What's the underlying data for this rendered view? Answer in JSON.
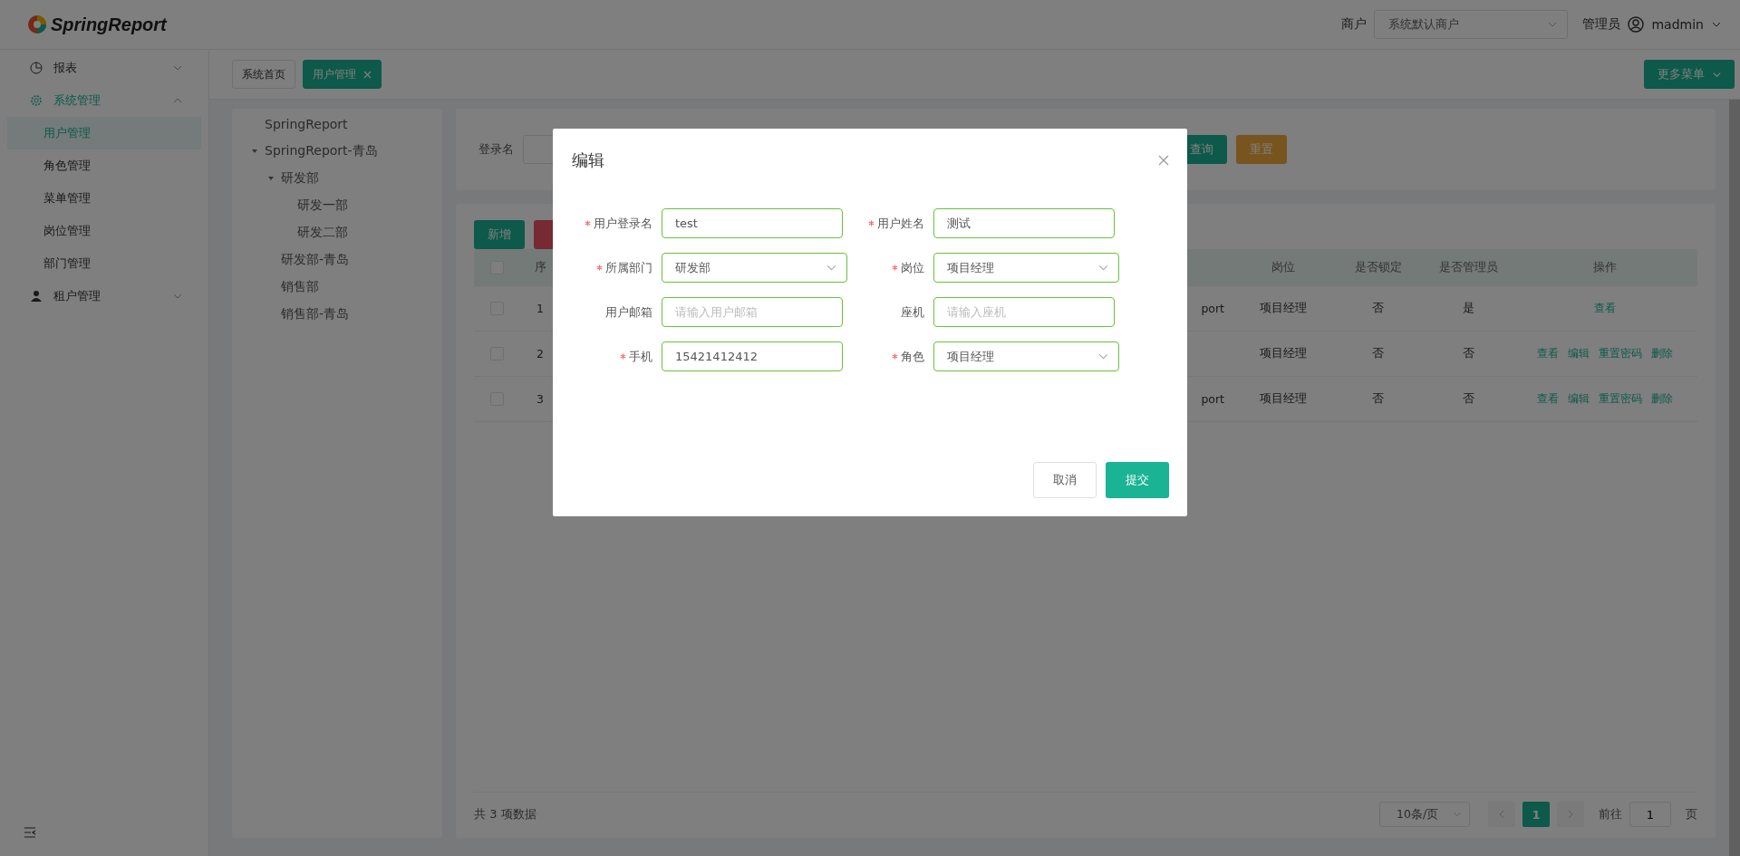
{
  "header": {
    "logo": "SpringReport",
    "merchant_label": "商户",
    "merchant_select": "系统默认商户",
    "role": "管理员",
    "user": "madmin"
  },
  "sidebar": {
    "items": [
      {
        "label": "报表",
        "selected": false,
        "expanded": false
      },
      {
        "label": "系统管理",
        "selected": true,
        "expanded": true,
        "children": [
          {
            "label": "用户管理",
            "selected": true
          },
          {
            "label": "角色管理",
            "selected": false
          },
          {
            "label": "菜单管理",
            "selected": false
          },
          {
            "label": "岗位管理",
            "selected": false
          },
          {
            "label": "部门管理",
            "selected": false
          }
        ]
      },
      {
        "label": "租户管理",
        "selected": false,
        "expanded": false
      }
    ]
  },
  "tabs": [
    {
      "label": "系统首页",
      "selected": false,
      "closable": false
    },
    {
      "label": "用户管理",
      "selected": true,
      "closable": true
    }
  ],
  "more_menu": "更多菜单",
  "tree": [
    {
      "label": "SpringReport"
    },
    {
      "label": "SpringReport-青岛",
      "expanded": true,
      "children": [
        {
          "label": "研发部",
          "expanded": true,
          "children": [
            {
              "label": "研发一部"
            },
            {
              "label": "研发二部"
            }
          ]
        },
        {
          "label": "研发部-青岛"
        },
        {
          "label": "销售部"
        },
        {
          "label": "销售部-青岛"
        }
      ]
    }
  ],
  "search": {
    "label": "登录名",
    "buttons": [
      {
        "label": "查询",
        "kind": "primary"
      },
      {
        "label": "重置",
        "kind": "warning"
      }
    ]
  },
  "toolbar": [
    {
      "label": "新增",
      "kind": "primary"
    },
    {
      "kind": "danger"
    }
  ],
  "table": {
    "header_checked": false,
    "columns": {
      "index": "序",
      "post": "岗位",
      "locked": "是否锁定",
      "admin": "是否管理员",
      "actions": "操作"
    },
    "rows": [
      {
        "checked": false,
        "index": "1",
        "column_3": "port",
        "post": "项目经理",
        "locked": "否",
        "admin": "是",
        "actions": [
          "查看"
        ]
      },
      {
        "checked": false,
        "index": "2",
        "post": "项目经理",
        "locked": "否",
        "admin": "否",
        "actions": [
          "查看",
          "编辑",
          "重置密码",
          "删除"
        ]
      },
      {
        "checked": false,
        "index": "3",
        "column_3": "port",
        "post": "项目经理",
        "locked": "否",
        "admin": "否",
        "actions": [
          "查看",
          "编辑",
          "重置密码",
          "删除"
        ]
      }
    ]
  },
  "pagination": {
    "total": "共 3 项数据",
    "page_size": "10条/页",
    "pages": [
      {
        "label": "1",
        "selected": true
      }
    ],
    "goto_label": "前往",
    "goto_value": "1",
    "goto_suffix": "页"
  },
  "dialog": {
    "title": "编辑",
    "fields": [
      {
        "label": "用户登录名",
        "required": true,
        "kind": "input",
        "value": "test"
      },
      {
        "label": "用户姓名",
        "required": true,
        "kind": "input",
        "value": "测试"
      },
      {
        "label": "所属部门",
        "required": true,
        "kind": "select",
        "value": "研发部"
      },
      {
        "label": "岗位",
        "required": true,
        "kind": "select",
        "value": "项目经理"
      },
      {
        "label": "用户邮箱",
        "required": false,
        "kind": "input",
        "placeholder": "请输入用户邮箱"
      },
      {
        "label": "座机",
        "required": false,
        "kind": "input",
        "placeholder": "请输入座机"
      },
      {
        "label": "手机",
        "required": true,
        "kind": "input",
        "value": "15421412412"
      },
      {
        "label": "角色",
        "required": true,
        "kind": "select",
        "value": "项目经理"
      }
    ],
    "buttons": [
      {
        "label": "取消",
        "kind": "default"
      },
      {
        "label": "提交",
        "kind": "primary"
      }
    ]
  }
}
